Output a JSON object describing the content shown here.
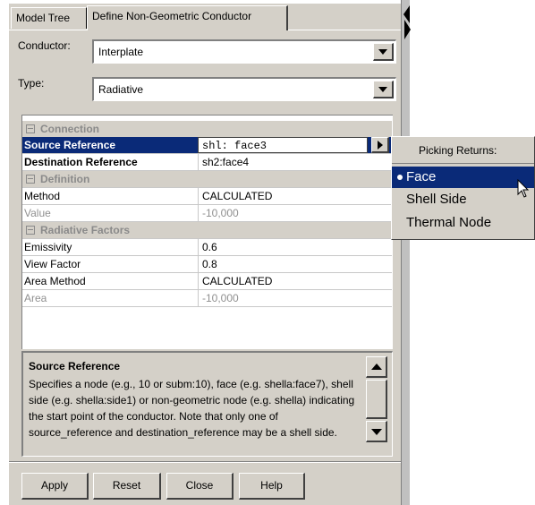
{
  "tabs": [
    {
      "label": "Model Tree",
      "active": false
    },
    {
      "label": "Define Non-Geometric Conductor",
      "active": true
    }
  ],
  "conductor": {
    "label": "Conductor:",
    "value": "Interplate"
  },
  "type": {
    "label": "Type:",
    "value": "Radiative"
  },
  "sections": {
    "connection": "Connection",
    "definition": "Definition",
    "radiative_factors": "Radiative Factors"
  },
  "rows": {
    "source_reference": {
      "name": "Source Reference",
      "value": "shl: face3"
    },
    "destination_reference": {
      "name": "Destination Reference",
      "value": "sh2:face4"
    },
    "method": {
      "name": "Method",
      "value": "CALCULATED"
    },
    "value": {
      "name": "Value",
      "value": "-10,000"
    },
    "emissivity": {
      "name": "Emissivity",
      "value": "0.6"
    },
    "view_factor": {
      "name": "View Factor",
      "value": "0.8"
    },
    "area_method": {
      "name": "Area Method",
      "value": "CALCULATED"
    },
    "area": {
      "name": "Area",
      "value": "-10,000"
    }
  },
  "description": {
    "title": "Source Reference",
    "body": "Specifies a node (e.g., 10 or subm:10), face (e.g. shella:face7), shell side (e.g. shella:side1) or non-geometric node (e.g. shella) indicating the start point of the conductor. Note that only one of source_reference and destination_reference may be a shell side."
  },
  "buttons": {
    "apply": "Apply",
    "reset": "Reset",
    "close": "Close",
    "help": "Help"
  },
  "popup": {
    "title": "Picking Returns:",
    "items": [
      "Face",
      "Shell Side",
      "Thermal Node"
    ],
    "selected": "Face"
  },
  "colors": {
    "selection": "#0a2a78",
    "panel": "#d4d0c8"
  }
}
